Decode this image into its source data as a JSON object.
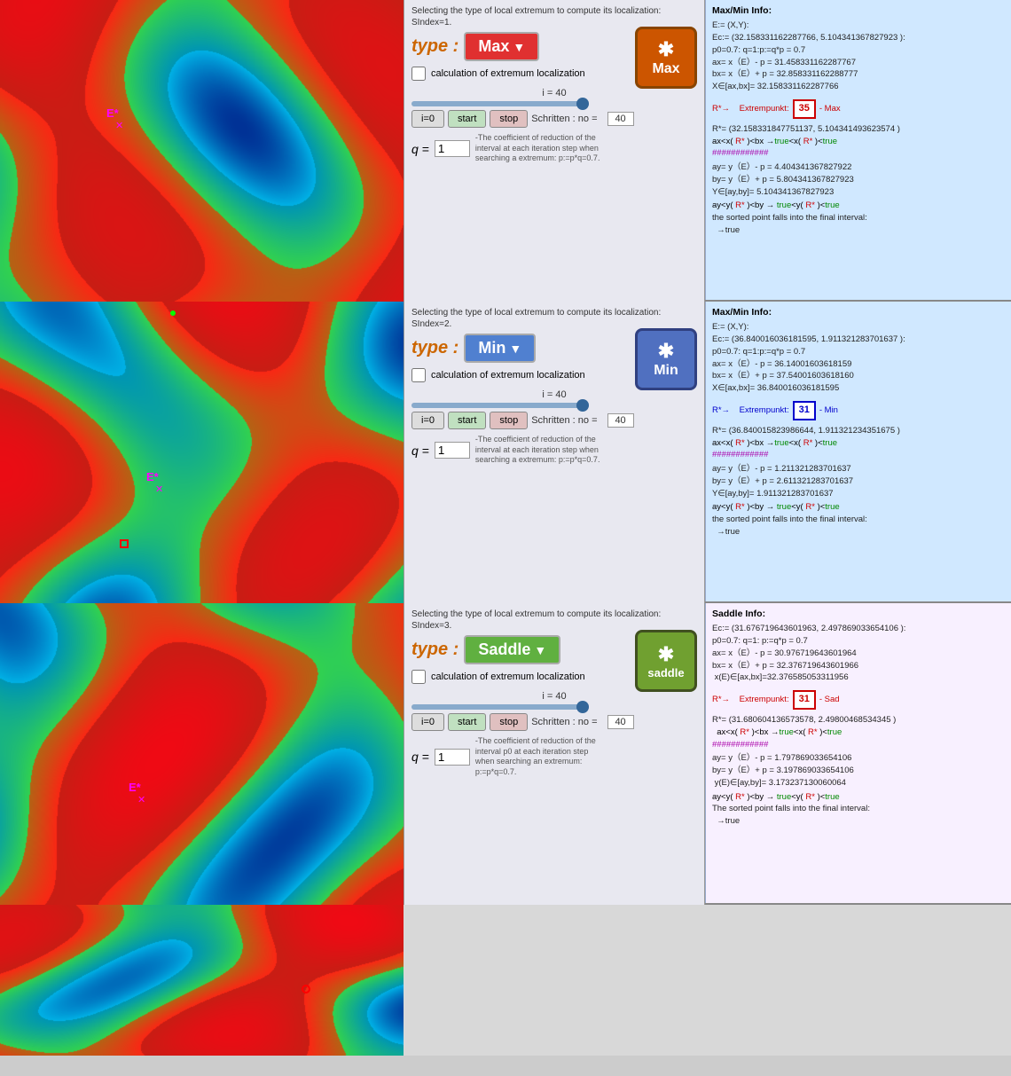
{
  "panels": [
    {
      "id": "max-panel",
      "type": "Max",
      "sindex": "1",
      "i_value": 40,
      "no_value": 40,
      "q_value": "1",
      "type_label": "type :",
      "big_btn_label": "Max",
      "big_btn_star": "*",
      "checkbox_label": "calculation of extremum localization",
      "i0_label": "i=0",
      "start_label": "start",
      "stop_label": "stop",
      "schritte_label": "Schritten :  no =",
      "q_label": "q =",
      "q_desc": "-The coefficient of reduction of the interval at each iteration step when searching a extremum: p:=p*q=0.7.",
      "ctrl_title": "Selecting the type of local extremum to compute its localization: SIndex=1.",
      "info_title": "Max/Min  Info:",
      "info_lines": [
        "E:= (X,Y):",
        "Ec:= (32.158331162287766, 5.104341367827923 ):",
        "p0=0.7:  q=1:p:=q*p = 0.7",
        "ax= x（E）- p = 31.458331162287767",
        "bx= x（E）+ p = 32.858331162288777",
        "X∈[ax,bx]= 32.158331162287766",
        "",
        "R*→    Extrempunkt:  35   - Max",
        "",
        "R*= (32.158331847751137, 5.104341493623574 )",
        "ax<x( R* )<bx →true<x( R* )<true",
        "############",
        "",
        "ay= y（E）- p = 4.404341367827922",
        "by= y（E）+ p = 5.804341367827923",
        "Y∈[ay,by]= 5.104341367827923",
        "",
        "ay<y( R* )<by → true<y( R* )<true",
        "the sorted point falls into the final interval:",
        "  →true"
      ],
      "extrempunkt_val": "35",
      "extrempunkt_type": "Max"
    },
    {
      "id": "min-panel",
      "type": "Min",
      "sindex": "2",
      "i_value": 40,
      "no_value": 40,
      "q_value": "1",
      "type_label": "type :",
      "big_btn_label": "Min",
      "big_btn_star": "*",
      "checkbox_label": "calculation of extremum localization",
      "i0_label": "i=0",
      "start_label": "start",
      "stop_label": "stop",
      "schritte_label": "Schritten :  no =",
      "q_label": "q =",
      "q_desc": "-The coefficient of reduction of the interval at each iteration step when searching a extremum: p:=p*q=0.7.",
      "ctrl_title": "Selecting the type of local extremum to compute its localization: SIndex=2.",
      "info_title": "Max/Min  Info:",
      "info_lines": [
        "E:= (X,Y):",
        "Ec:= (36.840016036181595, 1.911321283701637 ):",
        "p0=0.7:  q=1:p:=q*p = 0.7",
        "ax= x（E）- p = 36.14001603618159",
        "bx= x（E）+ p = 37.54001603618160",
        "X∈[ax,bx]= 36.840016036181595",
        "",
        "R*→    Extrempunkt:  31   - Min",
        "",
        "R*= (36.840015823986644, 1.911321234351675 )",
        "ax<x( R* )<bx →true<x( R* )<true",
        "############",
        "",
        "ay= y（E）- p = 1.211321283701637",
        "by= y（E）+ p = 2.611321283701637",
        "Y∈[ay,by]= 1.911321283701637",
        "",
        "ay<y( R* )<by → true<y( R* )<true",
        "the sorted point falls into the final interval:",
        "  →true"
      ],
      "extrempunkt_val": "31",
      "extrempunkt_type": "Min"
    },
    {
      "id": "saddle-panel",
      "type": "Saddle",
      "sindex": "3",
      "i_value": 40,
      "no_value": 40,
      "q_value": "1",
      "type_label": "type :",
      "big_btn_label": "saddle",
      "big_btn_star": "*",
      "checkbox_label": "calculation of extremum localization",
      "i0_label": "i=0",
      "start_label": "start",
      "stop_label": "stop",
      "schritte_label": "Schritten :  no =",
      "q_label": "q =",
      "q_desc": "-The coefficient of reduction of the interval p0 at each iteration step when searching an extremum: p:=p*q=0.7.",
      "ctrl_title": "Selecting the type of local extremum to compute its localization: SIndex=3.",
      "info_title": "Saddle  Info:",
      "info_lines": [
        "Ec:= (31.676719643601963, 2.497869033654106 ):",
        "p0=0.7:  q=1:  p:=q*p = 0.7",
        "ax= x（E）- p = 30.976719643601964",
        "bx= x（E）+ p = 32.376719643601966",
        " x(E)∈[ax,bx]=32.376585053311956",
        "",
        "R*→    Extrempunkt:  31   - Sad",
        "",
        "R*= (31.680604136573578, 2.49800468534345 )",
        "  ax<x( R* )<bx →true<x( R* )<true",
        "############",
        "",
        "ay= y（E）- p = 1.797869033654106",
        "by= y（E）+ p = 3.197869033654106",
        " y(E)∈[ay,by]= 3.173237130060064",
        "",
        "ay<y( R* )<by → true<y( R* )<true",
        "The sorted point falls into the final interval:",
        "  →true"
      ],
      "extrempunkt_val": "31",
      "extrempunkt_type": "Sad"
    }
  ],
  "panel4": {
    "description": "fourth partial panel showing another terrain view"
  }
}
